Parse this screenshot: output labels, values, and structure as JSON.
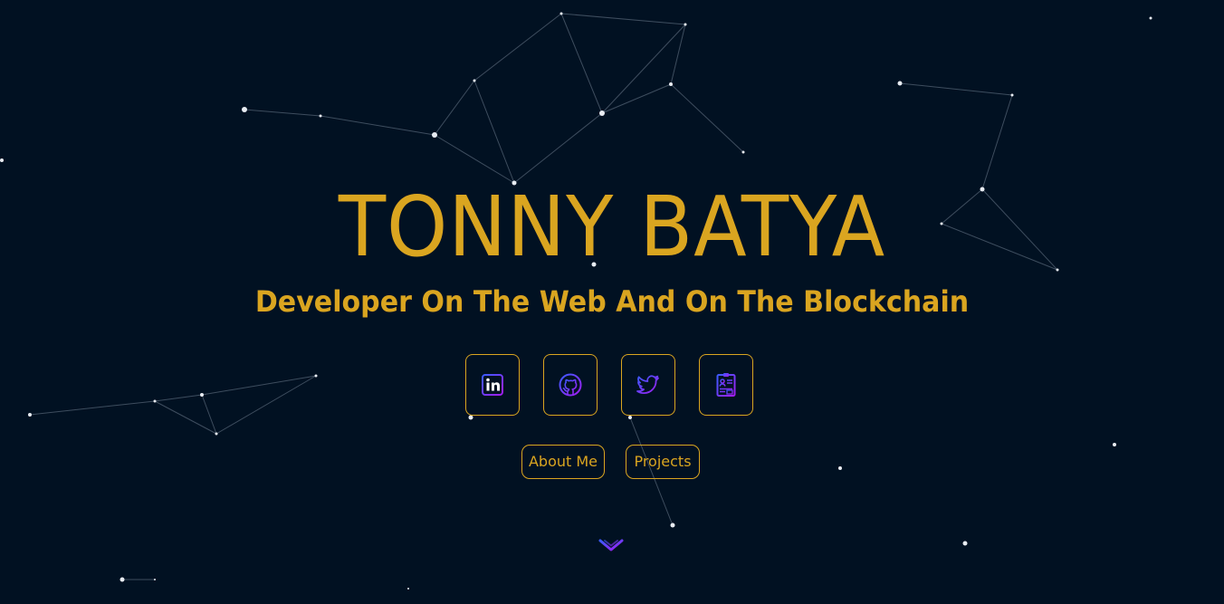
{
  "hero": {
    "name": "TONNY BATYA",
    "tagline": "Developer On The Web And On The Blockchain"
  },
  "socials": [
    {
      "icon": "linkedin-icon"
    },
    {
      "icon": "github-icon"
    },
    {
      "icon": "twitter-icon"
    },
    {
      "icon": "resume-icon"
    }
  ],
  "nav": {
    "about_label": "About Me",
    "projects_label": "Projects"
  },
  "scroll": {
    "icon": "chevron-down-icon"
  },
  "colors": {
    "background": "#011122",
    "accent": "#DAA520",
    "icon_gradient_start": "#3b5bff",
    "icon_gradient_end": "#a21cf0"
  }
}
